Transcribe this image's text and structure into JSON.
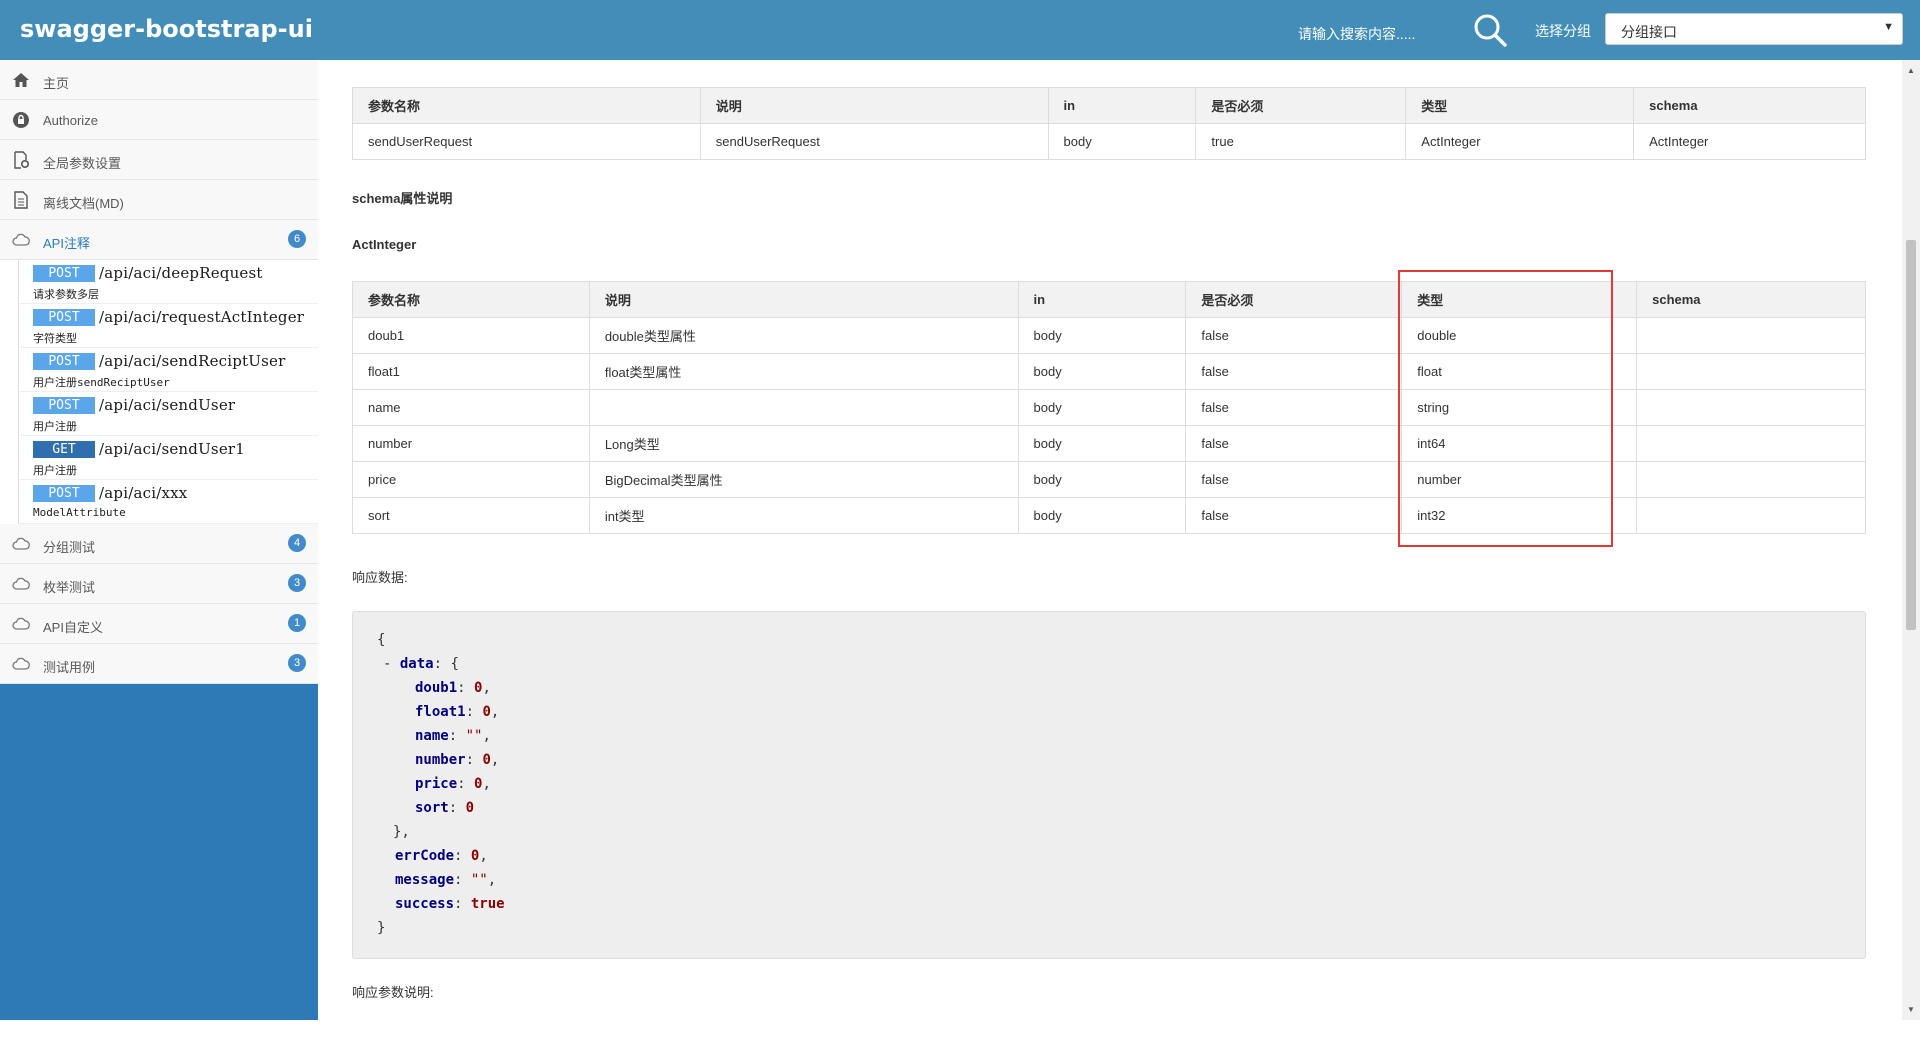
{
  "header": {
    "brand": "swagger-bootstrap-ui",
    "search_hint": "请输入搜索内容.....",
    "group_label": "选择分组",
    "group_value": "分组接口"
  },
  "sidebar": {
    "items_top": [
      {
        "label": "主页",
        "icon": "home-icon"
      },
      {
        "label": "Authorize",
        "icon": "lock-icon"
      },
      {
        "label": "全局参数设置",
        "icon": "settings-doc-icon"
      },
      {
        "label": "离线文档(MD)",
        "icon": "document-icon"
      }
    ],
    "api_group": {
      "label": "API注释",
      "badge": "6",
      "icon": "cloud-icon"
    },
    "api_items": [
      {
        "method": "POST",
        "path": "/api/aci/deepRequest",
        "desc": "请求参数多层"
      },
      {
        "method": "POST",
        "path": "/api/aci/requestActInteger",
        "desc": "字符类型"
      },
      {
        "method": "POST",
        "path": "/api/aci/sendReciptUser",
        "desc": "用户注册sendReciptUser"
      },
      {
        "method": "POST",
        "path": "/api/aci/sendUser",
        "desc": "用户注册"
      },
      {
        "method": "GET",
        "path": "/api/aci/sendUser1",
        "desc": "用户注册"
      },
      {
        "method": "POST",
        "path": "/api/aci/xxx",
        "desc": "ModelAttribute"
      }
    ],
    "groups_bottom": [
      {
        "label": "分组测试",
        "badge": "4"
      },
      {
        "label": "枚举测试",
        "badge": "3"
      },
      {
        "label": "API自定义",
        "badge": "1"
      },
      {
        "label": "测试用例",
        "badge": "3"
      }
    ]
  },
  "main": {
    "param_table": {
      "headers": [
        "参数名称",
        "说明",
        "in",
        "是否必须",
        "类型",
        "schema"
      ],
      "rows": [
        [
          "sendUserRequest",
          "sendUserRequest",
          "body",
          "true",
          "ActInteger",
          "ActInteger"
        ]
      ]
    },
    "schema_section_title": "schema属性说明",
    "schema_name": "ActInteger",
    "schema_table": {
      "headers": [
        "参数名称",
        "说明",
        "in",
        "是否必须",
        "类型",
        "schema"
      ],
      "rows": [
        [
          "doub1",
          "double类型属性",
          "body",
          "false",
          "double",
          ""
        ],
        [
          "float1",
          "float类型属性",
          "body",
          "false",
          "float",
          ""
        ],
        [
          "name",
          "",
          "body",
          "false",
          "string",
          ""
        ],
        [
          "number",
          "Long类型",
          "body",
          "false",
          "int64",
          ""
        ],
        [
          "price",
          "BigDecimal类型属性",
          "body",
          "false",
          "number",
          ""
        ],
        [
          "sort",
          "int类型",
          "body",
          "false",
          "int32",
          ""
        ]
      ]
    },
    "response_title": "响应数据:",
    "response_json": {
      "open": "{",
      "toggle": "-",
      "data_key": "data",
      "fields": [
        {
          "key": "doub1",
          "value": "0",
          "kind": "num"
        },
        {
          "key": "float1",
          "value": "0",
          "kind": "num"
        },
        {
          "key": "name",
          "value": "\"\"",
          "kind": "str"
        },
        {
          "key": "number",
          "value": "0",
          "kind": "num"
        },
        {
          "key": "price",
          "value": "0",
          "kind": "num"
        },
        {
          "key": "sort",
          "value": "0",
          "kind": "num"
        }
      ],
      "data_close": "},",
      "tail": [
        {
          "key": "errCode",
          "value": "0",
          "kind": "num"
        },
        {
          "key": "message",
          "value": "\"\"",
          "kind": "str"
        },
        {
          "key": "success",
          "value": "true",
          "kind": "num"
        }
      ],
      "close": "}"
    },
    "response_params_title": "响应参数说明:"
  },
  "colors": {
    "header_bg": "#438eb9",
    "sidebar_bg": "#2d7ab7",
    "post_method": "#5ba6e8",
    "get_method": "#2f6fae",
    "highlight_border": "#e53935"
  }
}
